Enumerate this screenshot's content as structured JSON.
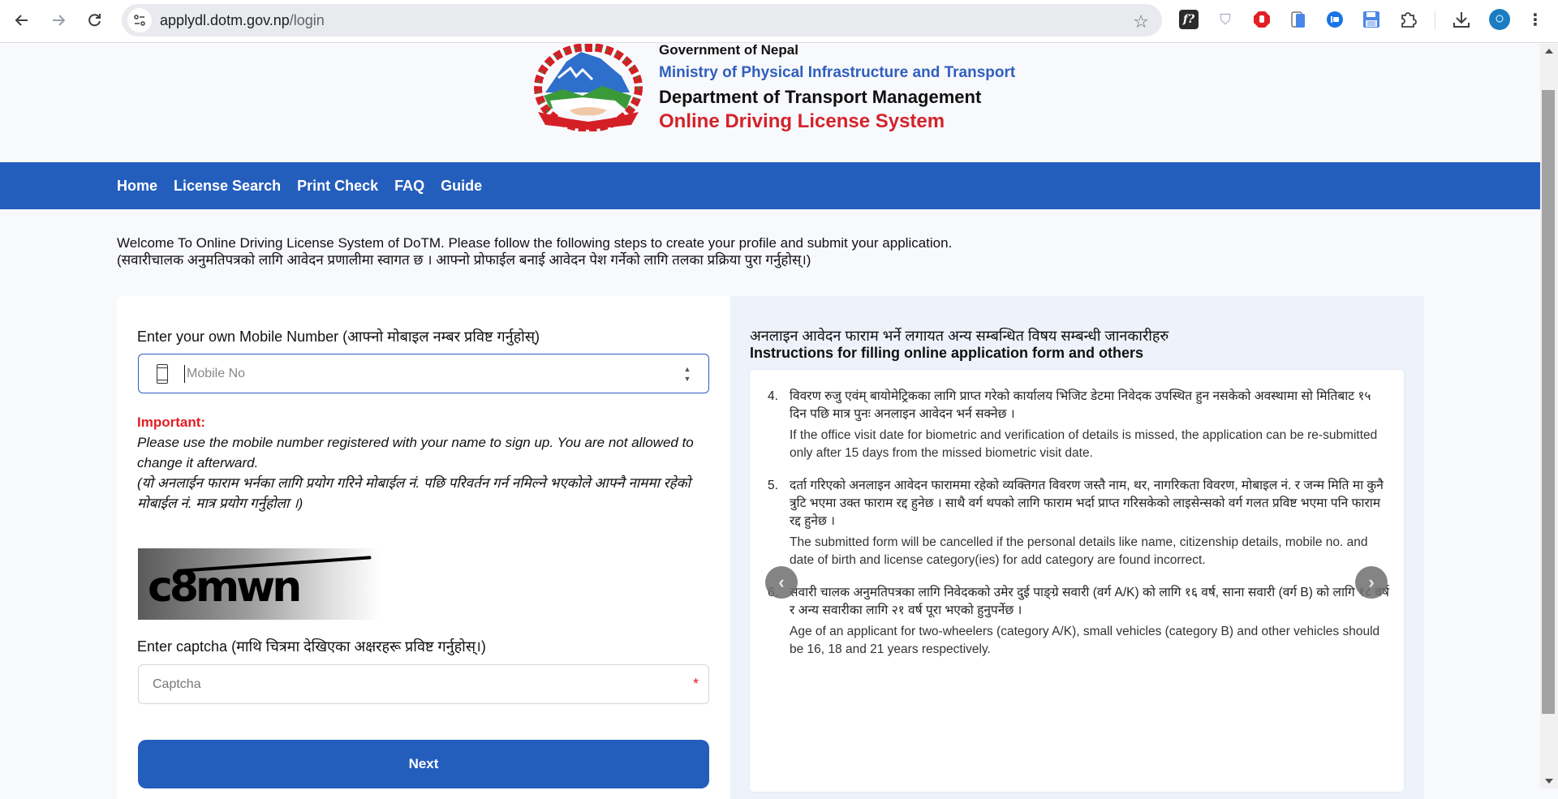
{
  "browser": {
    "url_host": "applydl.dotm.gov.np",
    "url_path": "/login",
    "extensions": [
      {
        "name": "font-identifier-extension-icon",
        "glyph": "f?",
        "color": "#2b2b2b"
      },
      {
        "name": "shield-extension-icon",
        "glyph": "◈",
        "color": "#9aa3b5"
      },
      {
        "name": "adblock-extension-icon",
        "glyph": "✋",
        "color": "#e31e24"
      },
      {
        "name": "tab-extension-icon",
        "glyph": "▯",
        "color": "#4a86e8"
      },
      {
        "name": "screencast-extension-icon",
        "glyph": "◉",
        "color": "#1a73e8"
      },
      {
        "name": "save-extension-icon",
        "glyph": "💾",
        "color": "#4a86e8"
      },
      {
        "name": "extensions-puzzle-icon",
        "glyph": "⧉",
        "color": "#3c4043"
      }
    ]
  },
  "header": {
    "gov": "Government of Nepal",
    "ministry": "Ministry of Physical Infrastructure and Transport",
    "department": "Department of Transport Management",
    "system": "Online Driving License System"
  },
  "nav": {
    "items": [
      "Home",
      "License Search",
      "Print Check",
      "FAQ",
      "Guide"
    ]
  },
  "welcome": {
    "en": "Welcome To Online Driving License System of DoTM. Please follow the following steps to create your profile and submit your application.",
    "np": "(सवारीचालक अनुमतिपत्रको लागि आवेदन प्रणालीमा स्वागत छ । आफ्नो प्रोफाईल बनाई आवेदन पेश गर्नेको लागि तलका प्रक्रिया पुरा गर्नुहोस्।)"
  },
  "form": {
    "mobile_label": "Enter your own Mobile Number (आफ्नो मोबाइल नम्बर प्रविष्ट गर्नुहोस्)",
    "mobile_placeholder": "Mobile No",
    "mobile_value": "",
    "important_label": "Important:",
    "important_en": "Please use the mobile number registered with your name to sign up. You are not allowed to change it afterward.",
    "important_np": "(यो अनलाईन फाराम भर्नका लागि प्रयोग गरिने मोबाईल नं. पछि परिवर्तन गर्न नमिल्ने भएकोले आफ्नै नाममा रहेको मोबाईल नं. मात्र प्रयोग गर्नुहोला ।)",
    "captcha_text": "c8mwn",
    "captcha_label": "Enter captcha (माथि चित्रमा देखिएका अक्षरहरू प्रविष्ट गर्नुहोस्।)",
    "captcha_placeholder": "Captcha",
    "captcha_value": "",
    "required_mark": "*",
    "next_label": "Next"
  },
  "instructions": {
    "title_np": "अनलाइन आवेदन फाराम भर्ने लगायत अन्य सम्बन्धित विषय सम्बन्धी जानकारीहरु",
    "title_en": "Instructions for filling online application form and others",
    "items": [
      {
        "num": "4.",
        "np": "विवरण रुजु एवंम् बायोमेट्रिकका लागि प्राप्त गरेको कार्यालय भिजिट डेटमा निवेदक उपस्थित हुन नसकेको अवस्थामा सो मितिबाट १५ दिन पछि मात्र पुनः अनलाइन आवेदन भर्न सक्नेछ ।",
        "en": "If the office visit date for biometric and verification of details is missed, the application can be re-submitted only after 15 days from the missed biometric visit date."
      },
      {
        "num": "5.",
        "np": "दर्ता गरिएको अनलाइन आवेदन फाराममा रहेको व्यक्तिगत विवरण जस्तै नाम, थर, नागरिकता विवरण, मोबाइल नं. र जन्म मिति मा कुनै त्रुटि भएमा उक्त फाराम रद्द हुनेछ । साथै वर्ग थपको लागि फाराम भर्दा प्राप्त गरिसकेको लाइसेन्सको वर्ग गलत प्रविष्ट भएमा पनि फाराम रद्द हुनेछ ।",
        "en": "The submitted form will be cancelled if the personal details like name, citizenship details, mobile no. and date of birth and license category(ies) for add category are found incorrect."
      },
      {
        "num": "6.",
        "np": "सवारी चालक अनुमतिपत्रका लागि निवेदकको उमेर दुई पाङ्ग्रे सवारी (वर्ग A/K) को लागि १६ वर्ष, साना सवारी (वर्ग B) को लागि १८ वर्ष र अन्य सवारीका लागि २१ वर्ष पूरा भएको हुनुपर्नेछ ।",
        "en": "Age of an applicant for two-wheelers (category A/K), small vehicles (category B) and other vehicles should be 16, 18 and 21 years respectively."
      }
    ],
    "prev_glyph": "‹",
    "next_glyph": "›"
  },
  "colors": {
    "brand_blue": "#245ebd",
    "ministry_blue": "#2f5fbd",
    "accent_red": "#d3232a",
    "important_red": "#e31e24"
  }
}
